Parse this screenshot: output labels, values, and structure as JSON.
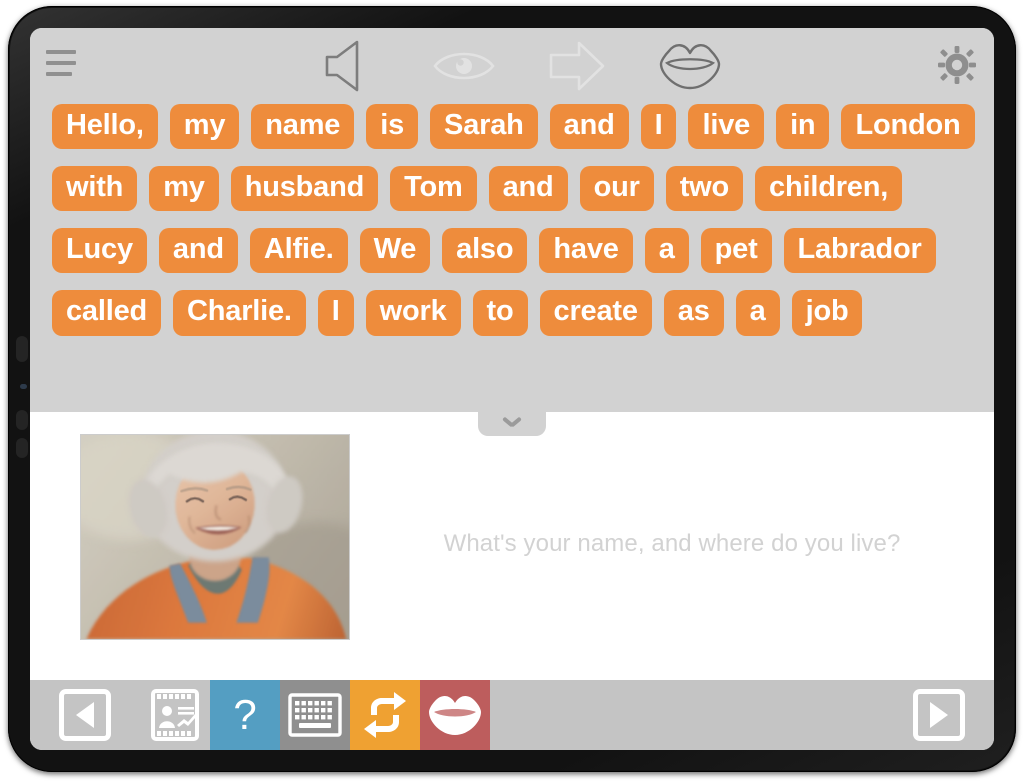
{
  "app": {
    "device": "tablet",
    "accent_orange": "#ee8c3c",
    "panel_gray": "#d2d2d2",
    "bar_gray": "#c4c4c4"
  },
  "top_toolbar": {
    "menu_label": "menu",
    "icons": [
      {
        "name": "speaker-icon",
        "label": "Speaker"
      },
      {
        "name": "eye-icon",
        "label": "Eye"
      },
      {
        "name": "arrow-right-icon",
        "label": "Next"
      },
      {
        "name": "mouth-icon",
        "label": "Mouth"
      }
    ],
    "settings_label": "Settings"
  },
  "word_bank": {
    "rows": [
      [
        "Hello,",
        "my",
        "name",
        "is",
        "Sarah",
        "and",
        "I",
        "live",
        "in",
        "London"
      ],
      [
        "with",
        "my",
        "husband",
        "Tom",
        "and",
        "our",
        "two",
        "children,"
      ],
      [
        "Lucy",
        "and",
        "Alfie.",
        "We",
        "also",
        "have",
        "a",
        "pet",
        "Labrador"
      ],
      [
        "called",
        "Charlie.",
        "I",
        "work",
        "to",
        "create",
        "as",
        "a",
        "job"
      ]
    ],
    "collapse_label": "Collapse"
  },
  "content": {
    "photo_alt": "Portrait photo of a smiling woman with grey hair wearing an orange jacket",
    "prompt": "What's your name, and where do you live?"
  },
  "bottom_toolbar": {
    "prev_label": "Previous",
    "next_label": "Next",
    "buttons": [
      {
        "name": "slides-button",
        "label": "Slides",
        "color": "#c4c4c4"
      },
      {
        "name": "help-button",
        "label": "?",
        "color": "#549ec2"
      },
      {
        "name": "keyboard-button",
        "label": "Keyboard",
        "color": "#8f8f8f"
      },
      {
        "name": "repeat-button",
        "label": "Repeat",
        "color": "#efa132"
      },
      {
        "name": "speak-button",
        "label": "Speak",
        "color": "#bd5d5d"
      }
    ]
  }
}
